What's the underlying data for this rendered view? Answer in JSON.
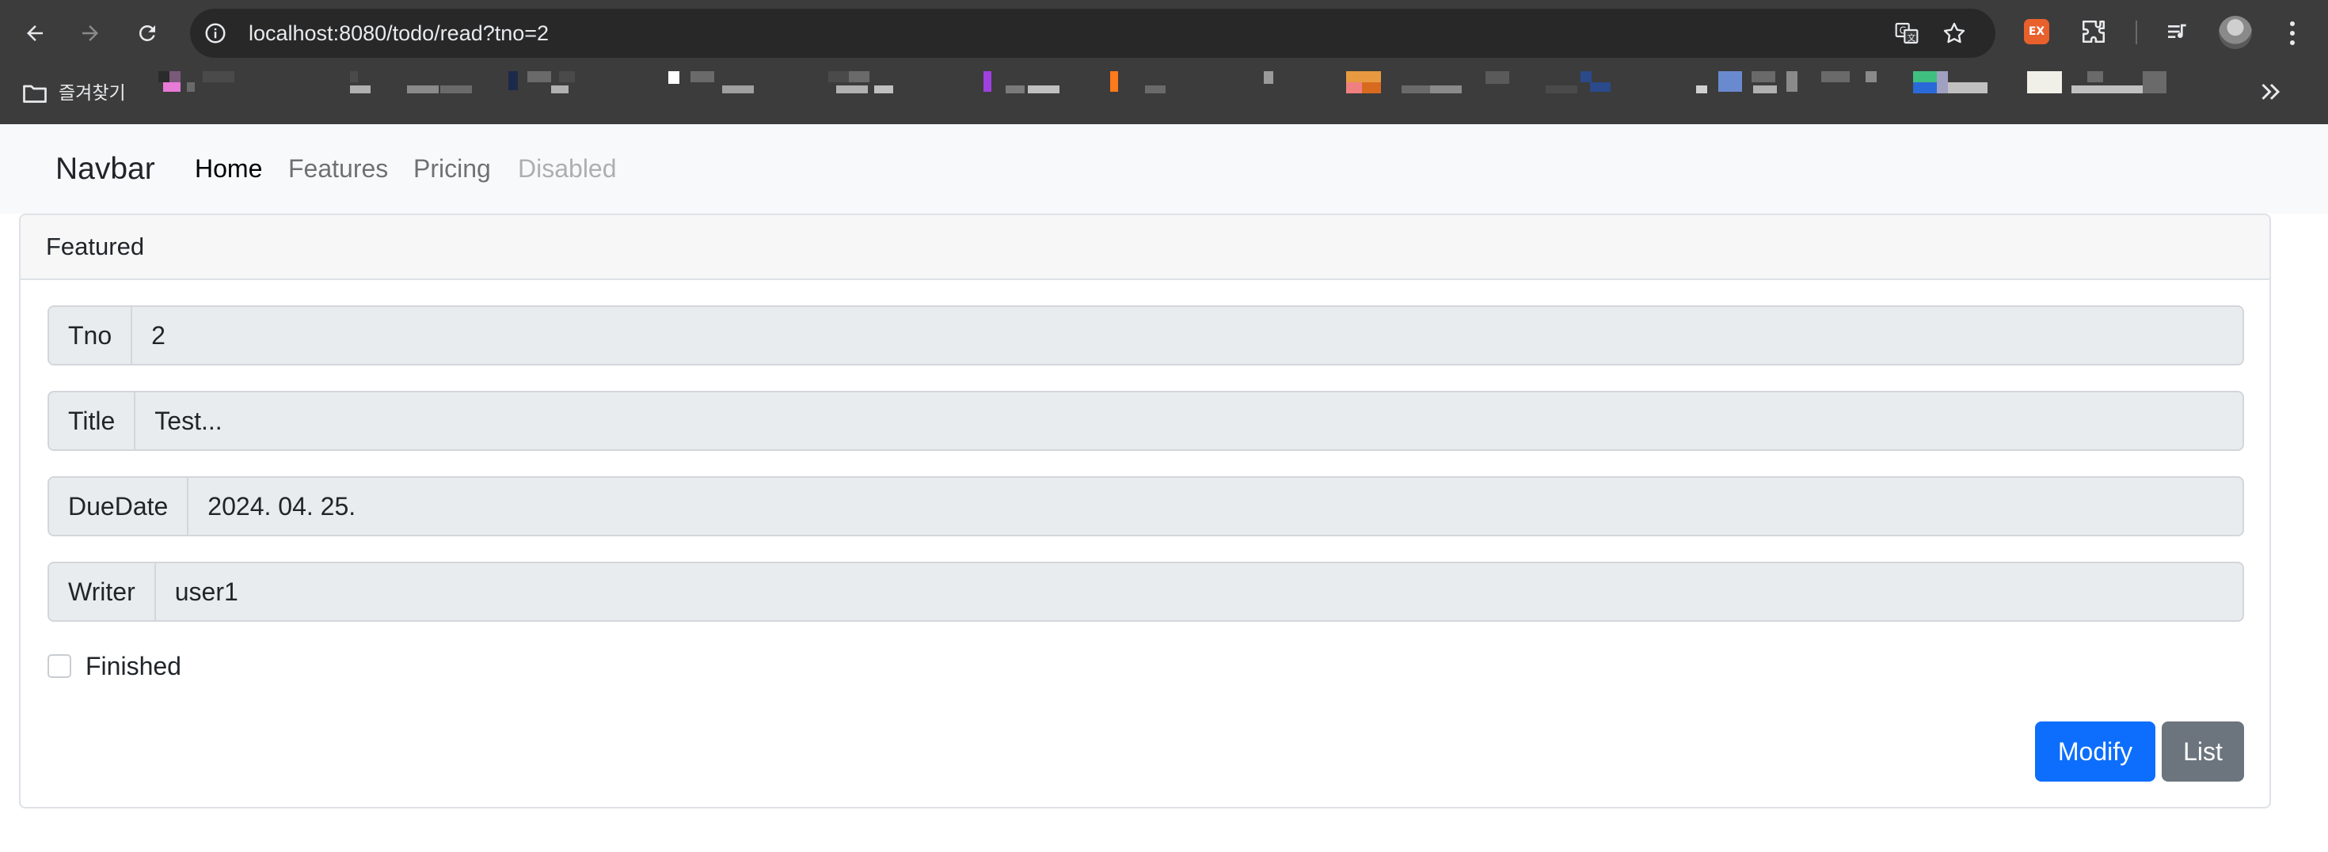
{
  "browser": {
    "url": "localhost:8080/todo/read?tno=2",
    "ext_badge": "EX",
    "bookmarks_label": "즐겨찾기"
  },
  "navbar": {
    "brand": "Navbar",
    "links": [
      {
        "label": "Home",
        "state": "active"
      },
      {
        "label": "Features",
        "state": "normal"
      },
      {
        "label": "Pricing",
        "state": "normal"
      },
      {
        "label": "Disabled",
        "state": "disabled"
      }
    ]
  },
  "card": {
    "header": "Featured",
    "fields": [
      {
        "label": "Tno",
        "value": "2"
      },
      {
        "label": "Title",
        "value": "Test..."
      },
      {
        "label": "DueDate",
        "value": "2024. 04. 25."
      },
      {
        "label": "Writer",
        "value": "user1"
      }
    ],
    "finished": {
      "label": "Finished",
      "checked": false
    },
    "buttons": {
      "modify": "Modify",
      "list": "List"
    }
  },
  "colors": {
    "chrome_bg": "#3c3c3c",
    "omnibox_bg": "#282828",
    "primary": "#0d6efd",
    "secondary": "#6c757d",
    "navbar_bg": "#f8f9fa",
    "input_readonly_bg": "#e9ecef"
  }
}
